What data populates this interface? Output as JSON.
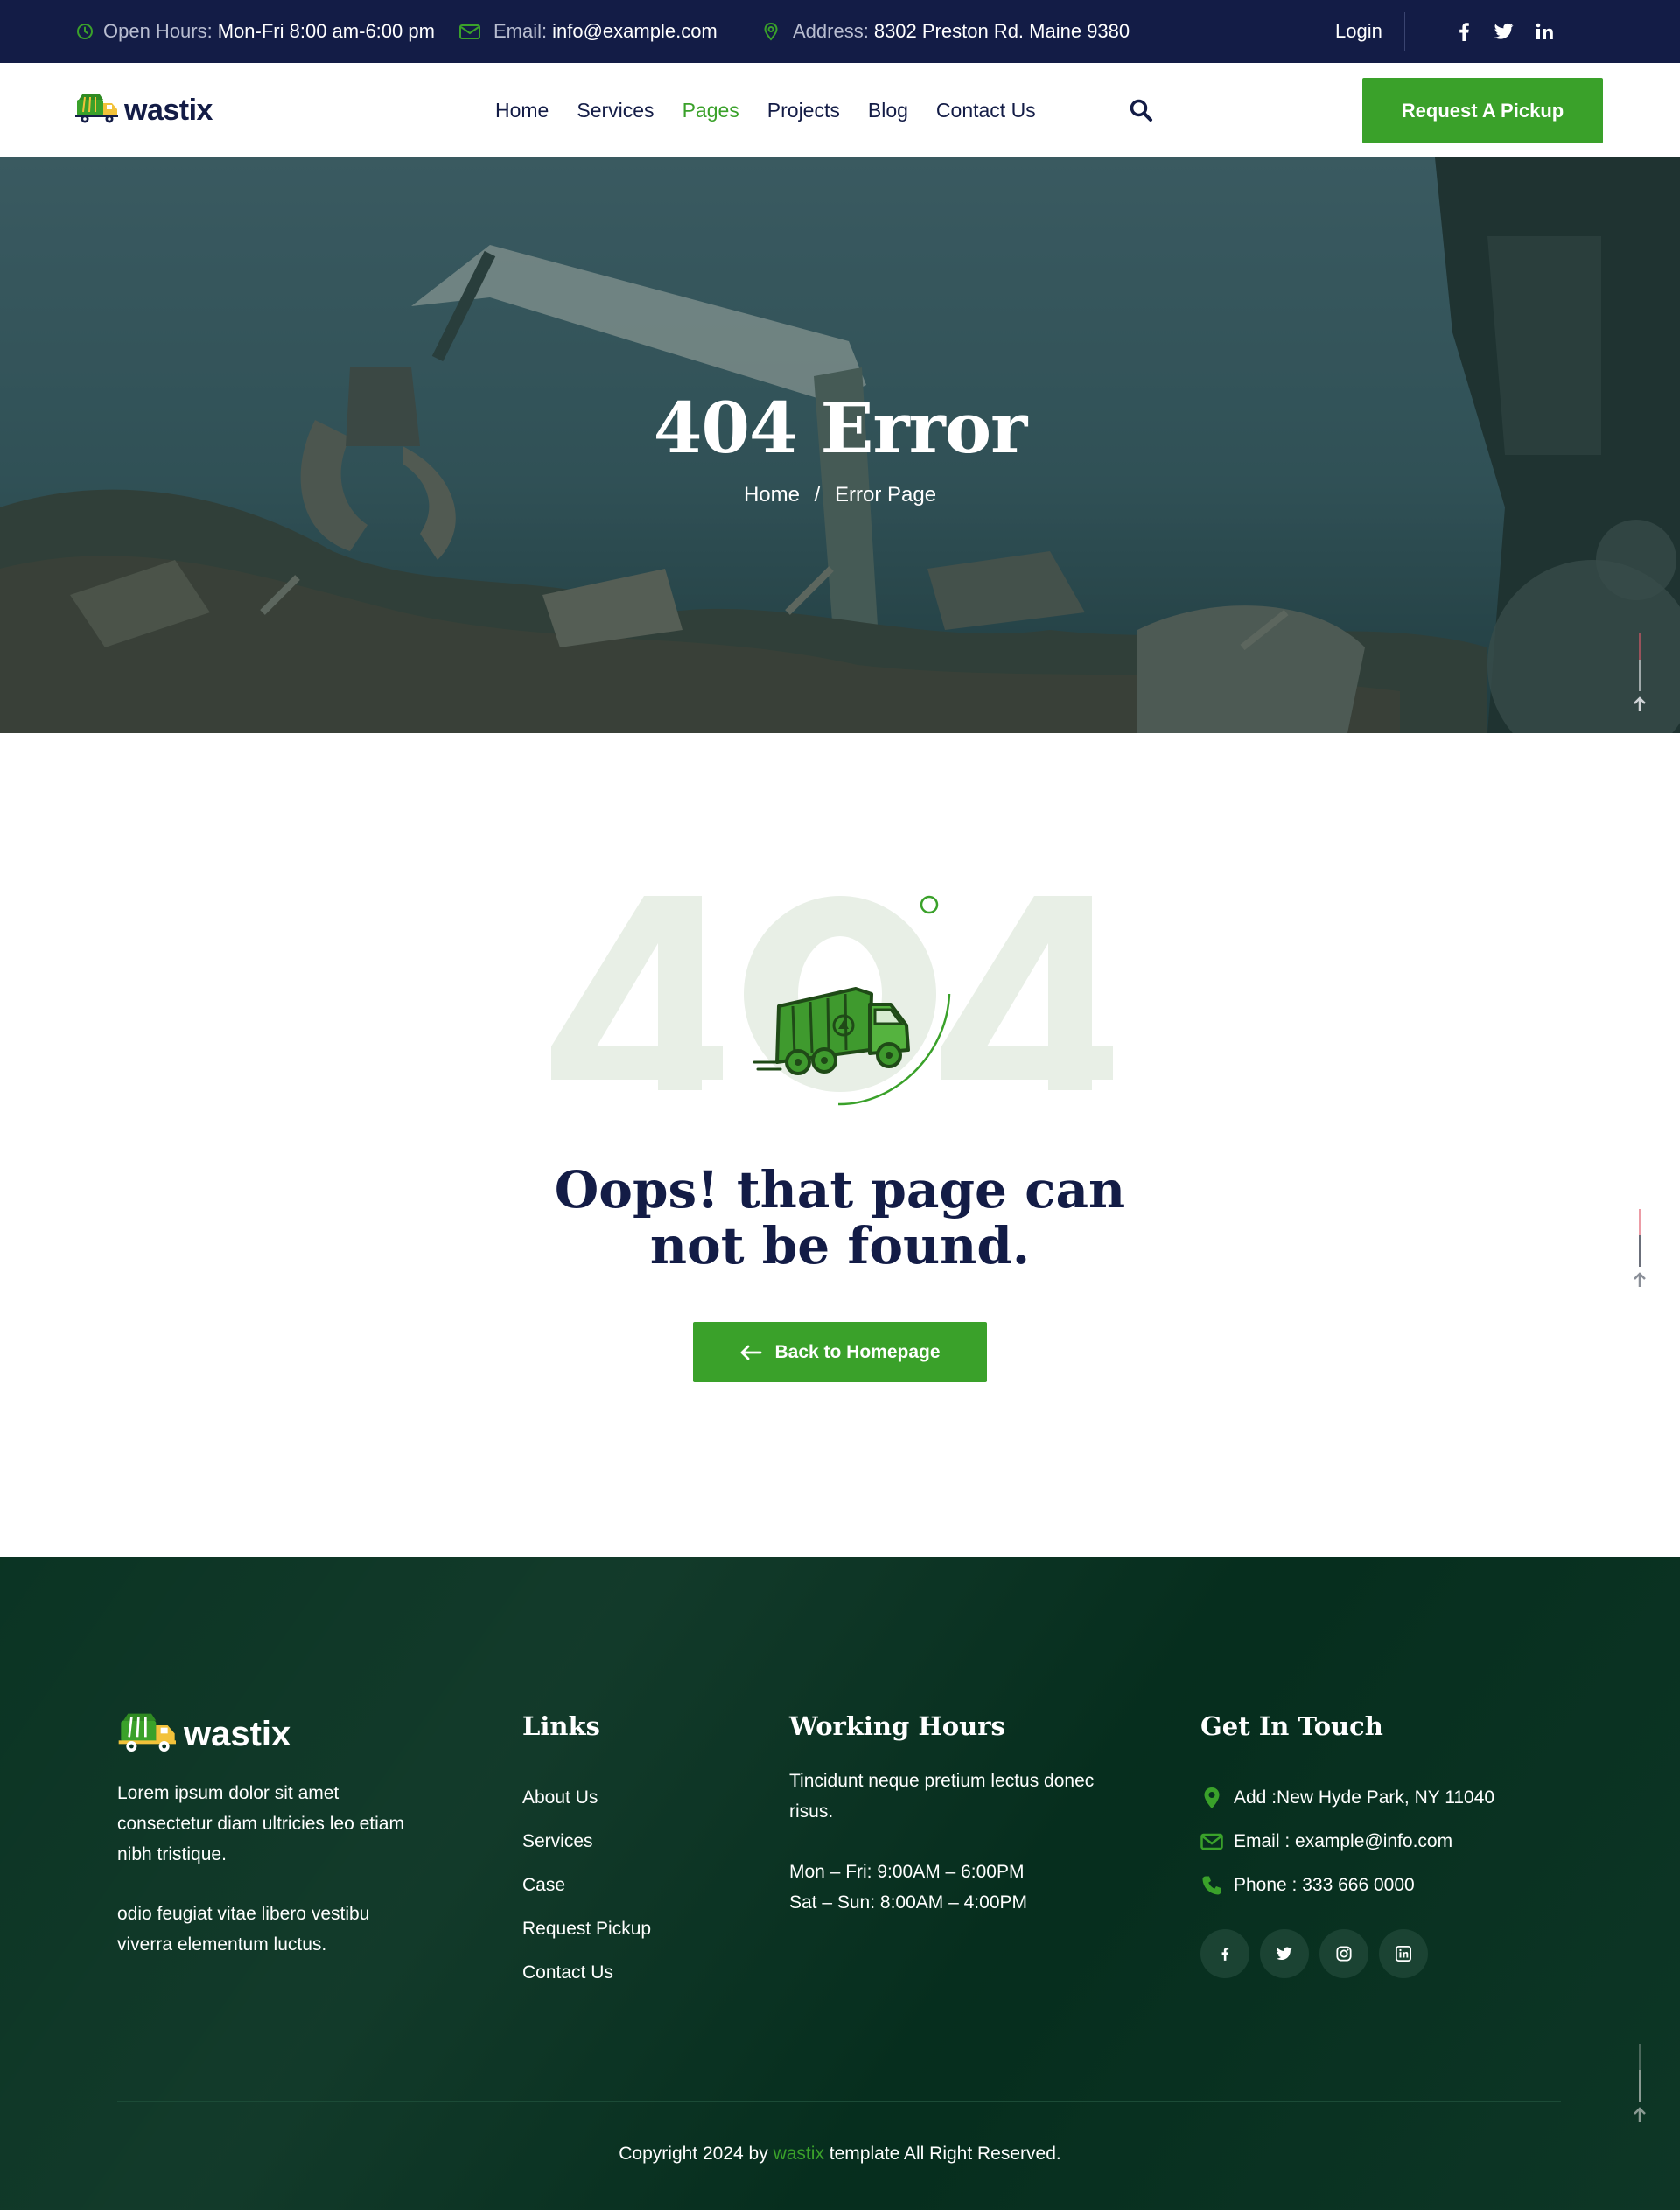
{
  "topbar": {
    "hours_label": "Open Hours:",
    "hours_value": "Mon-Fri 8:00 am-6:00 pm",
    "email_label": "Email:",
    "email_value": "info@example.com",
    "address_label": "Address:",
    "address_value": "8302 Preston Rd. Maine 9380",
    "login": "Login",
    "social_icons": [
      "facebook-icon",
      "twitter-icon",
      "linkedin-icon"
    ]
  },
  "nav": {
    "brand": "wastix",
    "items": [
      "Home",
      "Services",
      "Pages",
      "Projects",
      "Blog",
      "Contact Us"
    ],
    "active": "Pages",
    "cta": "Request A Pickup"
  },
  "hero": {
    "title": "404 Error",
    "breadcrumb": {
      "home": "Home",
      "separator": "/",
      "current": "Error Page"
    }
  },
  "error": {
    "digits": "404",
    "message": "Oops! that page can not be found.",
    "button": "Back to Homepage"
  },
  "footer": {
    "brand": "wastix",
    "about_1": "Lorem ipsum dolor sit amet consectetur diam ultricies leo etiam nibh tristique.",
    "about_2": "odio feugiat vitae libero vestibu viverra elementum luctus.",
    "links_heading": "Links",
    "links": [
      "About Us",
      "Services",
      "Case",
      "Request Pickup",
      "Contact Us"
    ],
    "hours_heading": "Working Hours",
    "hours_text": "Tincidunt neque pretium lectus donec risus.",
    "hours_weekday": "Mon – Fri: 9:00AM – 6:00PM",
    "hours_weekend": "Sat – Sun: 8:00AM – 4:00PM",
    "contact_heading": "Get In Touch",
    "contact_address": "Add :New Hyde Park, NY 11040",
    "contact_email": "Email : example@info.com",
    "contact_phone": "Phone : 333 666 0000",
    "social_icons": [
      "facebook-icon",
      "twitter-icon",
      "instagram-icon",
      "linkedin-icon"
    ],
    "copyright_pre": "Copyright 2024 by",
    "copyright_brand": "wastix",
    "copyright_post": "template All Right Reserved."
  },
  "colors": {
    "topbar_bg": "#131c46",
    "accent_green": "#3aa12a",
    "footer_bg": "#06301f",
    "heading_navy": "#131c46"
  }
}
